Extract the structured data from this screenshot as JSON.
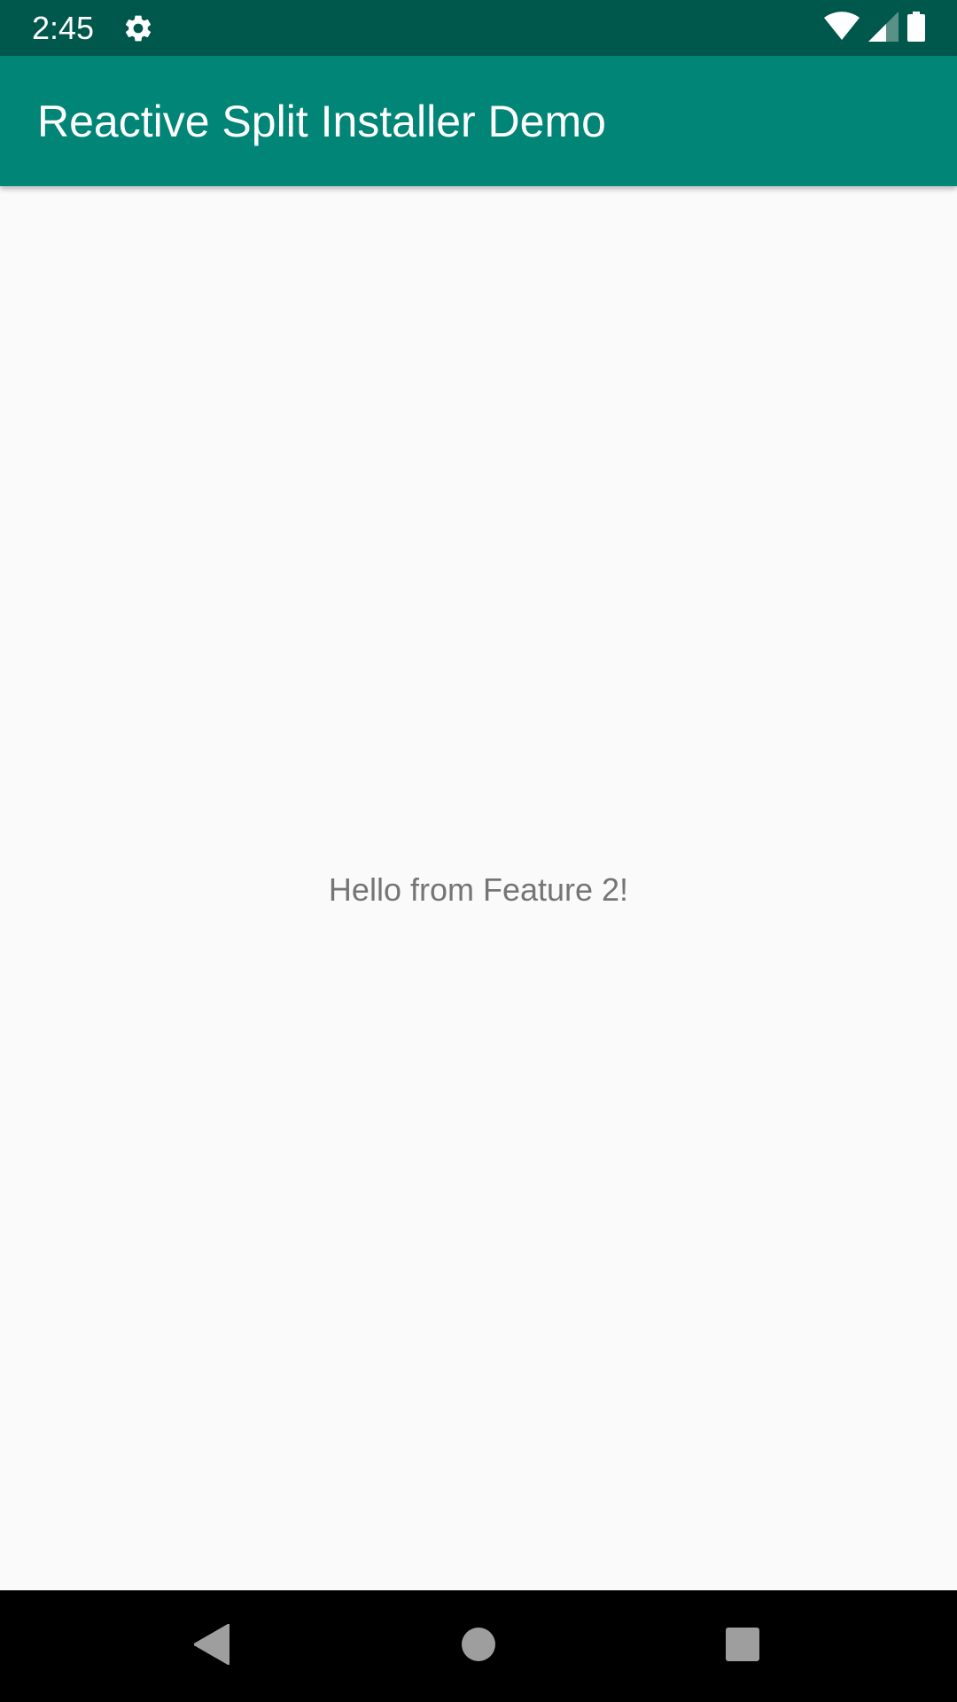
{
  "status_bar": {
    "time": "2:45",
    "icons": [
      "settings-gear-icon",
      "wifi-icon",
      "cell-signal-icon",
      "battery-icon"
    ],
    "background": "#00574b"
  },
  "app_bar": {
    "title": "Reactive Split Installer Demo",
    "background": "#008577"
  },
  "content": {
    "message": "Hello from Feature 2!",
    "background": "#fafafa",
    "text_color": "#757575"
  },
  "navigation_bar": {
    "buttons": [
      "back-icon",
      "home-icon",
      "recents-icon"
    ],
    "background": "#000000",
    "icon_color": "#9e9e9e"
  }
}
